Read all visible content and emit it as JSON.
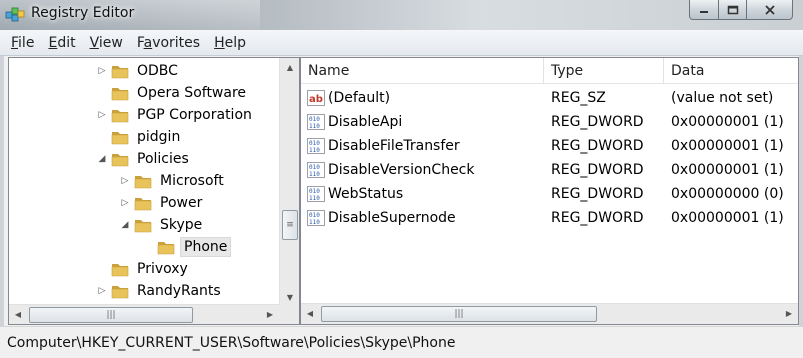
{
  "window": {
    "title": "Registry Editor"
  },
  "menu": [
    {
      "label": "File",
      "accel": "F",
      "rest": "ile"
    },
    {
      "label": "Edit",
      "accel": "E",
      "rest": "dit"
    },
    {
      "label": "View",
      "accel": "V",
      "rest": "iew"
    },
    {
      "label": "Favorites",
      "accel": "a",
      "pre": "F",
      "rest": "vorites"
    },
    {
      "label": "Help",
      "accel": "H",
      "rest": "elp"
    }
  ],
  "tree": [
    {
      "label": "ODBC",
      "depth": 0,
      "arrow": "collapsed"
    },
    {
      "label": "Opera Software",
      "depth": 0,
      "arrow": "none"
    },
    {
      "label": "PGP Corporation",
      "depth": 0,
      "arrow": "collapsed"
    },
    {
      "label": "pidgin",
      "depth": 0,
      "arrow": "none"
    },
    {
      "label": "Policies",
      "depth": 0,
      "arrow": "expanded"
    },
    {
      "label": "Microsoft",
      "depth": 1,
      "arrow": "collapsed"
    },
    {
      "label": "Power",
      "depth": 1,
      "arrow": "collapsed"
    },
    {
      "label": "Skype",
      "depth": 1,
      "arrow": "expanded"
    },
    {
      "label": "Phone",
      "depth": 2,
      "arrow": "none",
      "selected": true
    },
    {
      "label": "Privoxy",
      "depth": 0,
      "arrow": "none"
    },
    {
      "label": "RandyRants",
      "depth": 0,
      "arrow": "collapsed"
    }
  ],
  "list": {
    "columns": {
      "name": "Name",
      "type": "Type",
      "data": "Data"
    },
    "rows": [
      {
        "name": "(Default)",
        "type": "REG_SZ",
        "data": "(value not set)",
        "icon": "string-value-icon"
      },
      {
        "name": "DisableApi",
        "type": "REG_DWORD",
        "data": "0x00000001 (1)",
        "icon": "binary-value-icon"
      },
      {
        "name": "DisableFileTransfer",
        "type": "REG_DWORD",
        "data": "0x00000001 (1)",
        "icon": "binary-value-icon"
      },
      {
        "name": "DisableVersionCheck",
        "type": "REG_DWORD",
        "data": "0x00000001 (1)",
        "icon": "binary-value-icon"
      },
      {
        "name": "WebStatus",
        "type": "REG_DWORD",
        "data": "0x00000000 (0)",
        "icon": "binary-value-icon"
      },
      {
        "name": "DisableSupernode",
        "type": "REG_DWORD",
        "data": "0x00000001 (1)",
        "icon": "binary-value-icon"
      }
    ]
  },
  "status": {
    "path": "Computer\\HKEY_CURRENT_USER\\Software\\Policies\\Skype\\Phone"
  },
  "colors": {
    "folder": "#e8c25a",
    "folder_dark": "#c9a03a",
    "selection": "#e8e8e8",
    "menubar": "#e4e9ef"
  }
}
